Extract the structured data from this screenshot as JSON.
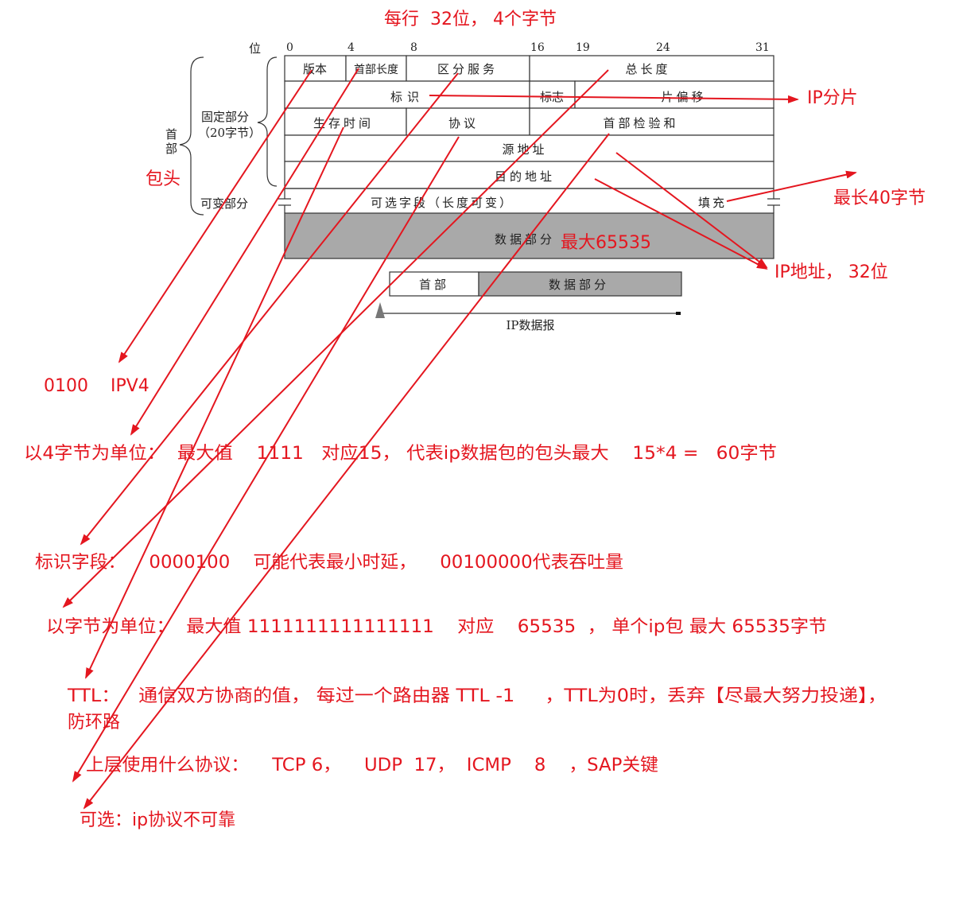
{
  "diagram": {
    "bit_header": "位",
    "bit_marks": [
      "0",
      "4",
      "8",
      "16",
      "19",
      "24",
      "31"
    ],
    "fields": {
      "version": "版本",
      "ihl": "首部长度",
      "tos": "区分服务",
      "total_length": "总长度",
      "identification": "标识",
      "flags": "标志",
      "fragment_offset": "片偏移",
      "ttl": "生存时间",
      "protocol": "协议",
      "checksum": "首部检验和",
      "src_addr": "源地址",
      "dst_addr": "目的地址",
      "options": "可选字段（长度可变）",
      "padding": "填充",
      "data": "数据部分"
    },
    "left_labels": {
      "header_line1": "首",
      "header_line2": "部",
      "fixed_line1": "固定部分",
      "fixed_line2": "（20字节）",
      "variable": "可变部分"
    },
    "datagram": {
      "header": "首部",
      "data": "数据部分",
      "caption": "IP数据报"
    }
  },
  "annotations": {
    "row_width": "每行  32位， 4个字节",
    "fragmentation": "IP分片",
    "header_label": "包头",
    "options_max": "最长40字节",
    "data_max": "最大65535",
    "ip_address": "IP地址， 32位",
    "version_note": "0100    IPV4",
    "ihl_note": "以4字节为单位：  最大值    1111   对应15， 代表ip数据包的包头最大    15*4 =   60字节",
    "tos_note": "标识字段：    0000100    可能代表最小时延，    00100000代表吞吐量",
    "total_length_note": "以字节为单位：  最大值 1111111111111111    对应    65535  ， 单个ip包 最大 65535字节",
    "ttl_note_line1": "TTL：   通信双方协商的值， 每过一个路由器 TTL -1     ，TTL为0时，丢弃【尽最大努力投递】，",
    "ttl_note_line2": "防环路",
    "protocol_note": "上层使用什么协议：    TCP 6，    UDP  17，  ICMP    8    ，SAP关键",
    "options_note": "可选：ip协议不可靠"
  },
  "colors": {
    "annotation": "#e4161f",
    "data_fill": "#a9a9a9",
    "lines": "#333333"
  }
}
